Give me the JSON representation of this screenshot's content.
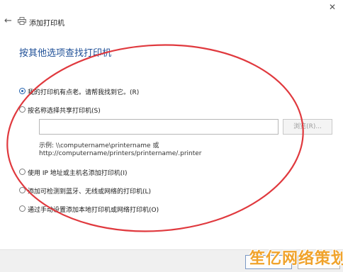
{
  "window": {
    "title": "添加打印机",
    "back_glyph": "←",
    "close_glyph": "✕"
  },
  "heading": "按其他选项查找打印机",
  "options": [
    {
      "label": "我的打印机有点老。请帮我找到它。(R)",
      "selected": true
    },
    {
      "label": "按名称选择共享打印机(S)",
      "selected": false
    },
    {
      "label": "使用 IP 地址或主机名添加打印机(I)",
      "selected": false
    },
    {
      "label": "添加可检测到蓝牙、无线或网络的打印机(L)",
      "selected": false
    },
    {
      "label": "通过手动设置添加本地打印机或网络打印机(O)",
      "selected": false
    }
  ],
  "share_field": {
    "value": "",
    "browse_label": "浏览(R)...",
    "example_line1": "示例: \\\\computername\\printername 或",
    "example_line2": "http://computername/printers/printername/.printer"
  },
  "watermark": "笙亿网络策划",
  "colors": {
    "heading": "#1e4f97",
    "annotation": "#e0393e",
    "watermark": "#f0a32c"
  }
}
